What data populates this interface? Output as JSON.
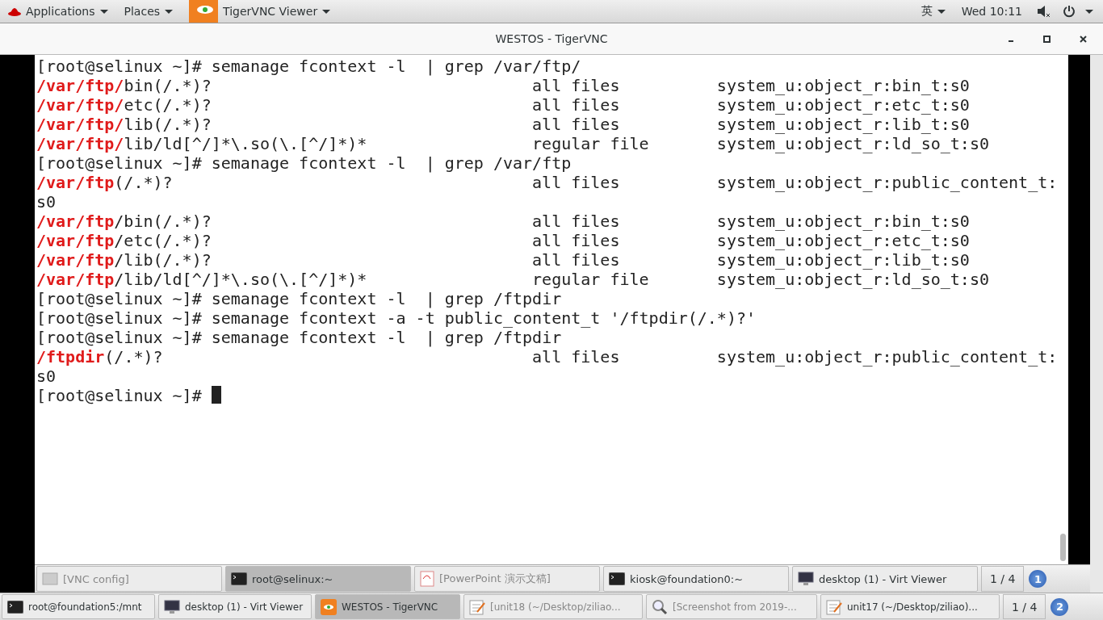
{
  "top_bar": {
    "menus": [
      {
        "label": "Applications",
        "kind": "apps"
      },
      {
        "label": "Places",
        "kind": "plain"
      },
      {
        "label": "TigerVNC Viewer",
        "kind": "app"
      }
    ],
    "input_method": "英",
    "clock": "Wed 10:11"
  },
  "window": {
    "title": "WESTOS - TigerVNC"
  },
  "terminal": {
    "lines": [
      {
        "kind": "prompt",
        "prompt": "[root@selinux ~]#",
        "command": "semanage fcontext -l  | grep /var/ftp/"
      },
      {
        "kind": "entry",
        "path": "/var/ftp/",
        "rest": "bin(/.*)?",
        "type": "all files",
        "context": "system_u:object_r:bin_t:s0"
      },
      {
        "kind": "entry",
        "path": "/var/ftp/",
        "rest": "etc(/.*)?",
        "type": "all files",
        "context": "system_u:object_r:etc_t:s0"
      },
      {
        "kind": "entry",
        "path": "/var/ftp/",
        "rest": "lib(/.*)?",
        "type": "all files",
        "context": "system_u:object_r:lib_t:s0"
      },
      {
        "kind": "entry",
        "path": "/var/ftp/",
        "rest": "lib/ld[^/]*\\.so(\\.[^/]*)*",
        "type": "regular file",
        "context": "system_u:object_r:ld_so_t:s0"
      },
      {
        "kind": "prompt",
        "prompt": "[root@selinux ~]#",
        "command": "semanage fcontext -l  | grep /var/ftp"
      },
      {
        "kind": "entry",
        "path": "/var/ftp",
        "rest": "(/.*)?",
        "type": "all files",
        "context": "system_u:object_r:public_content_t:"
      },
      {
        "kind": "wrap",
        "text": "s0"
      },
      {
        "kind": "entry",
        "path": "/var/ftp",
        "rest": "/bin(/.*)?",
        "type": "all files",
        "context": "system_u:object_r:bin_t:s0"
      },
      {
        "kind": "entry",
        "path": "/var/ftp",
        "rest": "/etc(/.*)?",
        "type": "all files",
        "context": "system_u:object_r:etc_t:s0"
      },
      {
        "kind": "entry",
        "path": "/var/ftp",
        "rest": "/lib(/.*)?",
        "type": "all files",
        "context": "system_u:object_r:lib_t:s0"
      },
      {
        "kind": "entry",
        "path": "/var/ftp",
        "rest": "/lib/ld[^/]*\\.so(\\.[^/]*)*",
        "type": "regular file",
        "context": "system_u:object_r:ld_so_t:s0"
      },
      {
        "kind": "prompt",
        "prompt": "[root@selinux ~]#",
        "command": "semanage fcontext -l  | grep /ftpdir"
      },
      {
        "kind": "prompt",
        "prompt": "[root@selinux ~]#",
        "command": "semanage fcontext -a -t public_content_t '/ftpdir(/.*)?'"
      },
      {
        "kind": "prompt",
        "prompt": "[root@selinux ~]#",
        "command": "semanage fcontext -l  | grep /ftpdir"
      },
      {
        "kind": "entry",
        "path": "/ftpdir",
        "rest": "(/.*)?",
        "type": "all files",
        "context": "system_u:object_r:public_content_t:"
      },
      {
        "kind": "wrap",
        "text": "s0"
      },
      {
        "kind": "cursor",
        "prompt": "[root@selinux ~]#"
      }
    ]
  },
  "inner_taskbar": {
    "items": [
      {
        "label": "[VNC config]",
        "kind": "window",
        "selected": false
      },
      {
        "label": "root@selinux:~",
        "kind": "terminal",
        "selected": true
      },
      {
        "label": "[PowerPoint 演示文稿]",
        "kind": "doc",
        "selected": false
      },
      {
        "label": "kiosk@foundation0:~",
        "kind": "terminal",
        "selected": false
      },
      {
        "label": "desktop (1) - Virt Viewer",
        "kind": "monitor",
        "selected": false
      }
    ],
    "pager": "1 / 4",
    "badge": "1"
  },
  "outer_taskbar": {
    "items": [
      {
        "label": "root@foundation5:/mnt",
        "kind": "terminal",
        "selected": false
      },
      {
        "label": "desktop (1) - Virt Viewer",
        "kind": "monitor",
        "selected": false
      },
      {
        "label": "WESTOS - TigerVNC",
        "kind": "tiger",
        "selected": true
      },
      {
        "label": "[unit18 (~/Desktop/ziliao...",
        "kind": "editor",
        "selected": false
      },
      {
        "label": "[Screenshot from 2019-...",
        "kind": "viewer",
        "selected": false
      },
      {
        "label": "unit17 (~/Desktop/ziliao)...",
        "kind": "editor",
        "selected": false
      }
    ],
    "pager": "1 / 4",
    "badge": "2"
  }
}
